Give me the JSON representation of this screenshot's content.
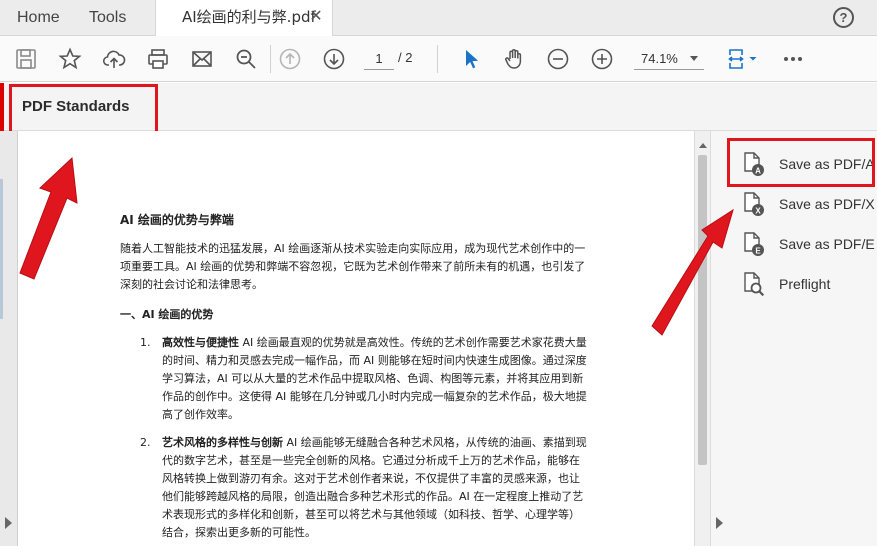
{
  "tabs": {
    "home": "Home",
    "tools": "Tools",
    "document_title": "AI绘画的利与弊.pdf",
    "close_glyph": "✕",
    "help_glyph": "?"
  },
  "toolbar": {
    "current_page": "1",
    "page_total": "/ 2",
    "zoom": "74.1%",
    "icons": [
      "save-icon",
      "star-icon",
      "upload-icon",
      "print-icon",
      "mail-icon",
      "search-zoom-icon",
      "prev-page-icon",
      "next-page-icon",
      "select-arrow-icon",
      "hand-icon",
      "zoom-out-icon",
      "zoom-in-icon",
      "fit-width-icon",
      "more-icon"
    ]
  },
  "tool_header": {
    "title": "PDF Standards"
  },
  "pane": {
    "items": [
      {
        "label": "Save as PDF/A",
        "icon": "pdf-a-icon"
      },
      {
        "label": "Save as PDF/X",
        "icon": "pdf-x-icon"
      },
      {
        "label": "Save as PDF/E",
        "icon": "pdf-e-icon"
      },
      {
        "label": "Preflight",
        "icon": "preflight-icon"
      }
    ]
  },
  "document": {
    "title": "AI 绘画的优势与弊端",
    "intro": "随着人工智能技术的迅猛发展，AI 绘画逐渐从技术实验走向实际应用，成为现代艺术创作中的一项重要工具。AI 绘画的优势和弊端不容忽视，它既为艺术创作带来了前所未有的机遇，也引发了深刻的社会讨论和法律思考。",
    "section1": "一、AI 绘画的优势",
    "items": [
      {
        "num": "1.",
        "bold": "高效性与便捷性",
        "text": " AI 绘画最直观的优势就是高效性。传统的艺术创作需要艺术家花费大量的时间、精力和灵感去完成一幅作品，而 AI 则能够在短时间内快速生成图像。通过深度学习算法，AI 可以从大量的艺术作品中提取风格、色调、构图等元素，并将其应用到新作品的创作中。这使得 AI 能够在几分钟或几小时内完成一幅复杂的艺术作品，极大地提高了创作效率。"
      },
      {
        "num": "2.",
        "bold": "艺术风格的多样性与创新",
        "text": " AI 绘画能够无缝融合各种艺术风格，从传统的油画、素描到现代的数字艺术，甚至是一些完全创新的风格。它通过分析成千上万的艺术作品，能够在风格转换上做到游刃有余。这对于艺术创作者来说，不仅提供了丰富的灵感来源，也让他们能够跨越风格的局限，创造出融合多种艺术形式的作品。AI 在一定程度上推动了艺术表现形式的多样化和创新，甚至可以将艺术与其他领域（如科技、哲学、心理学等）结合，探索出更多新的可能性。"
      }
    ]
  },
  "colors": {
    "highlight": "#e0161e",
    "accent_blue": "#1a73c8"
  }
}
